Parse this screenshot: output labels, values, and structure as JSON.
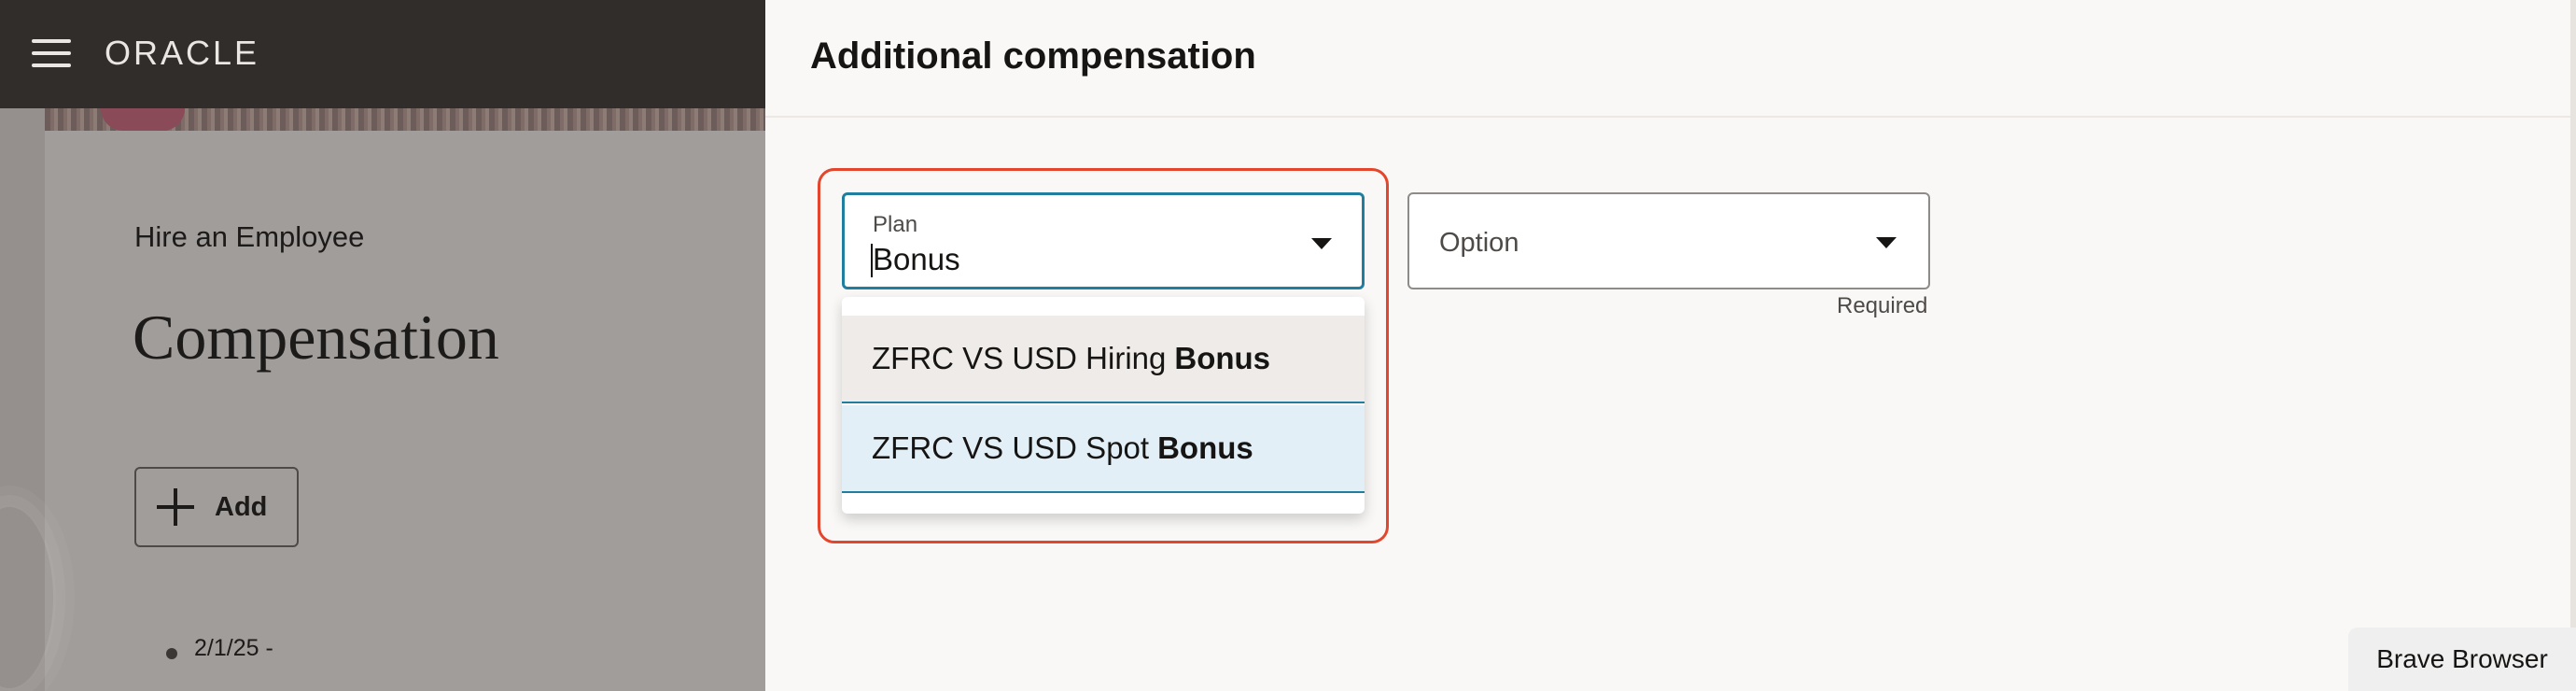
{
  "app": {
    "logo_text": "ORACLE"
  },
  "background_page": {
    "breadcrumb": "Hire an Employee",
    "title": "Compensation",
    "add_button_label": "Add",
    "list_item_date": "2/1/25 -"
  },
  "drawer": {
    "title": "Additional compensation",
    "plan": {
      "label": "Plan",
      "value": "Bonus"
    },
    "option": {
      "placeholder": "Option",
      "helper": "Required"
    },
    "dropdown_items": [
      {
        "prefix": "ZFRC VS USD Hiring",
        "match": "Bonus"
      },
      {
        "prefix": "ZFRC VS USD Spot",
        "match": "Bonus"
      }
    ]
  },
  "browser_label": "Brave Browser",
  "colors": {
    "topbar": "#312d2a",
    "focus_border": "#227e9e",
    "highlight_outline": "#e3452d",
    "selected_item": "#e2eff7"
  },
  "icons": [
    "hamburger-icon",
    "plus-icon",
    "chevron-down-icon"
  ]
}
